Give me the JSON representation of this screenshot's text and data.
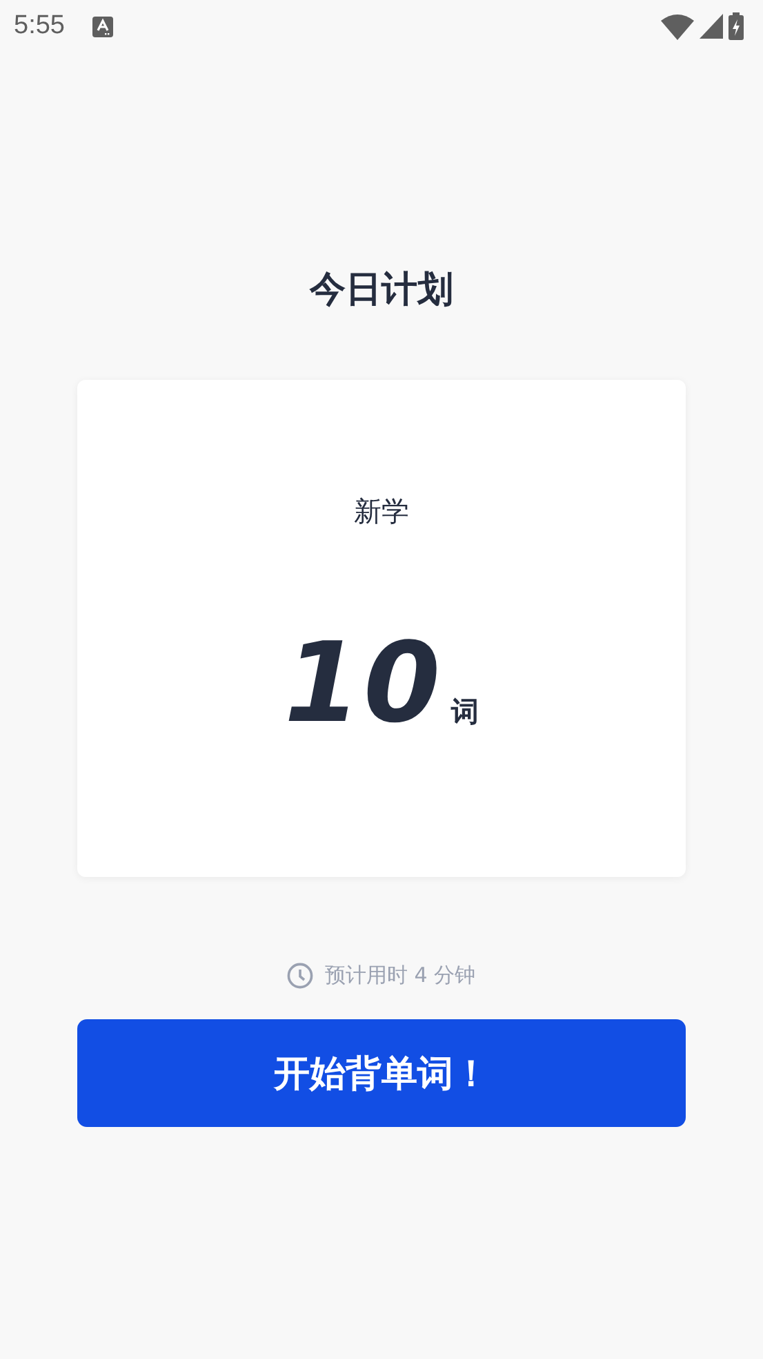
{
  "status_bar": {
    "time": "5:55"
  },
  "title": "今日计划",
  "plan_card": {
    "label": "新学",
    "count": "10",
    "unit": "词"
  },
  "estimate": "预计用时 4 分钟",
  "start_button": "开始背单词！"
}
